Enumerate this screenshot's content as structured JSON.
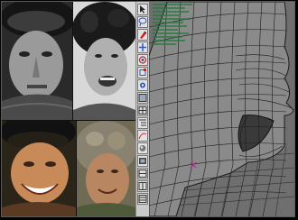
{
  "layout": {
    "photos": [
      {
        "name": "reference-photo-top-left",
        "tone": "bw"
      },
      {
        "name": "reference-photo-top-right",
        "tone": "bw"
      },
      {
        "name": "reference-photo-bottom-left",
        "tone": "color"
      },
      {
        "name": "reference-photo-bottom-right",
        "tone": "color"
      }
    ],
    "toolbar": {
      "tools": [
        {
          "name": "select-tool-icon"
        },
        {
          "name": "lasso-tool-icon"
        },
        {
          "name": "paint-tool-icon"
        },
        {
          "name": "move-tool-icon"
        },
        {
          "name": "rotate-tool-icon"
        },
        {
          "name": "scale-tool-icon"
        },
        {
          "name": "manipulator-tool-icon"
        },
        {
          "name": "single-view-icon"
        },
        {
          "name": "four-view-icon"
        },
        {
          "name": "outliner-icon"
        },
        {
          "name": "graph-editor-icon"
        },
        {
          "name": "hypershade-icon"
        },
        {
          "name": "render-view-icon"
        },
        {
          "name": "layout-icon"
        },
        {
          "name": "layout-icon-2"
        },
        {
          "name": "layout-icon-3"
        }
      ]
    },
    "viewport": {
      "background": "#6f6f6f",
      "wire_color": "#1b1b1b",
      "mesh_color": "#8a8a8a",
      "attribute_rows": 12
    }
  },
  "colors": {
    "accent": "#cc2222",
    "tool_blue": "#3355bb",
    "grid": "#3b3b3b"
  }
}
